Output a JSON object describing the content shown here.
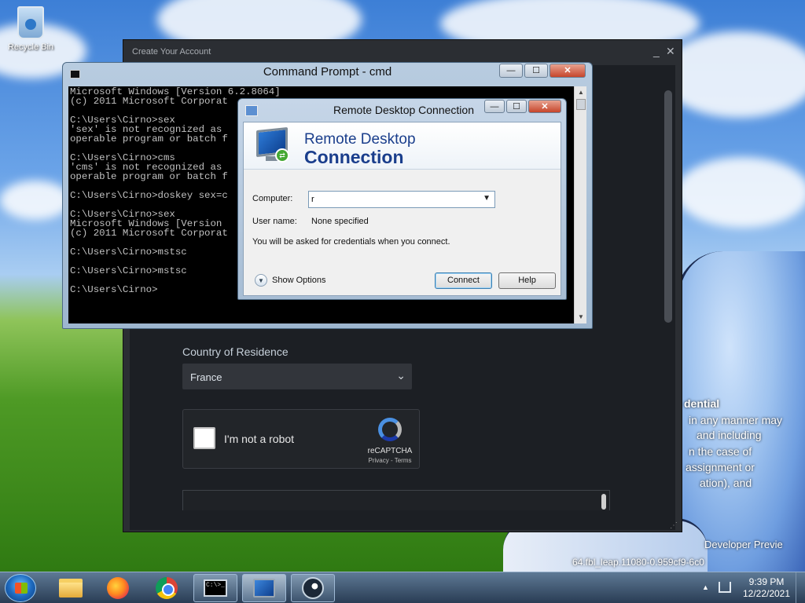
{
  "desktop": {
    "recycle_bin_label": "Recycle Bin",
    "behind_text": [
      "dential",
      "in any manner may",
      "and including",
      "n the case of",
      "assignment or",
      "ation), and"
    ],
    "watermark_line1": "Developer Previe",
    "watermark_line2": "64.fbl_leap.11080-0.959cf9-6c0"
  },
  "steam": {
    "title": "Create Your Account",
    "minimize_glyph": "_",
    "close_glyph": "✕",
    "country_label": "Country of Residence",
    "country_value": "France",
    "captcha_label": "I'm not a robot",
    "captcha_brand": "reCAPTCHA",
    "captcha_links": "Privacy - Terms"
  },
  "cmd": {
    "title": "Command Prompt - cmd",
    "minimize_glyph": "—",
    "maximize_glyph": "☐",
    "close_glyph": "✕",
    "lines": [
      "Microsoft Windows [Version 6.2.8064]",
      "(c) 2011 Microsoft Corporat",
      "",
      "C:\\Users\\Cirno>sex",
      "'sex' is not recognized as",
      "operable program or batch f",
      "",
      "C:\\Users\\Cirno>cms",
      "'cms' is not recognized as",
      "operable program or batch f",
      "",
      "C:\\Users\\Cirno>doskey sex=c",
      "",
      "C:\\Users\\Cirno>sex",
      "Microsoft Windows [Version",
      "(c) 2011 Microsoft Corporat",
      "",
      "C:\\Users\\Cirno>mstsc",
      "",
      "C:\\Users\\Cirno>mstsc",
      "",
      "C:\\Users\\Cirno>"
    ]
  },
  "rdc": {
    "title": "Remote Desktop Connection",
    "minimize_glyph": "—",
    "maximize_glyph": "☐",
    "close_glyph": "✕",
    "banner_line1": "Remote Desktop",
    "banner_line2": "Connection",
    "computer_label": "Computer:",
    "computer_value": "r",
    "username_label": "User name:",
    "username_value": "None specified",
    "credentials_note": "You will be asked for credentials when you connect.",
    "show_options": "Show Options",
    "connect_button": "Connect",
    "help_button": "Help"
  },
  "taskbar": {
    "cmd_icon_text": "C:\\>_",
    "clock_time": "9:39 PM",
    "clock_date": "12/22/2021"
  }
}
